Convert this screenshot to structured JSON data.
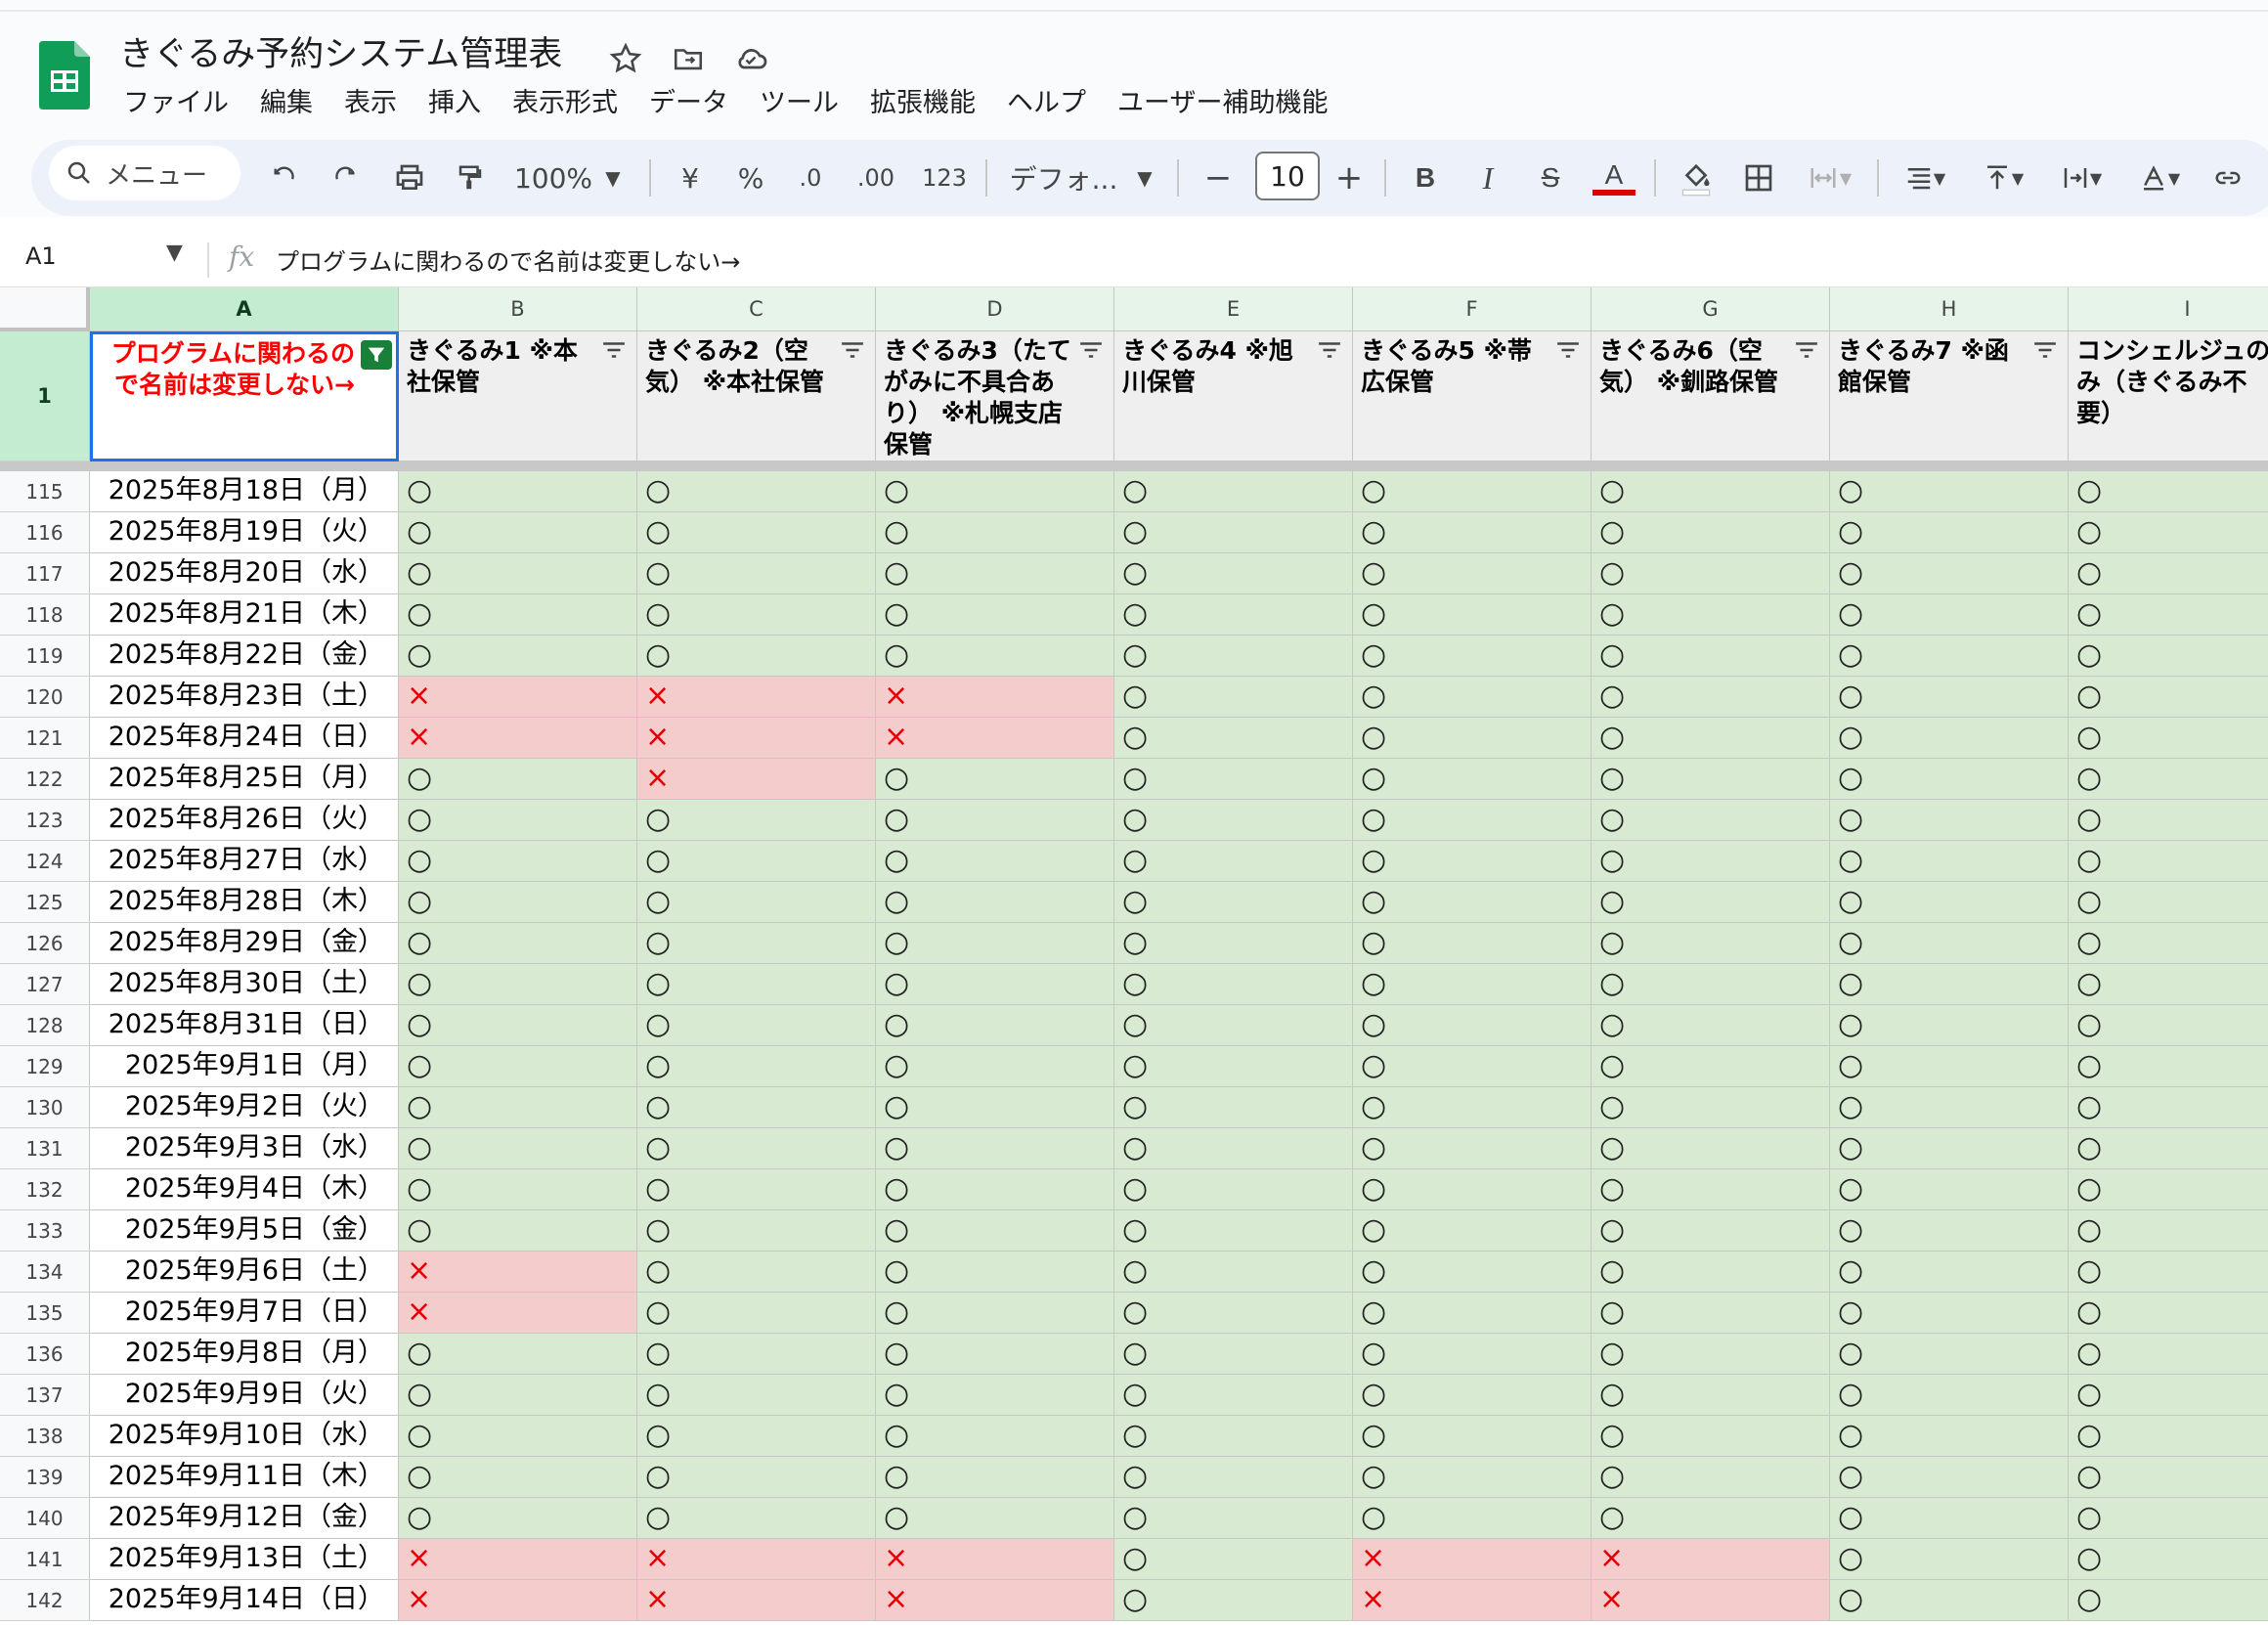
{
  "app": {
    "doc_title": "きぐるみ予約システム管理表",
    "menu": [
      "ファイル",
      "編集",
      "表示",
      "挿入",
      "表示形式",
      "データ",
      "ツール",
      "拡張機能",
      "ヘルプ",
      "ユーザー補助機能"
    ],
    "icons": [
      "star-icon",
      "move-folder-icon",
      "cloud-status-icon"
    ]
  },
  "toolbar": {
    "search_label": "メニュー",
    "zoom": "100%",
    "currency": "¥",
    "percent": "%",
    "decrease_decimal": ".0",
    "increase_decimal": ".00",
    "number_format": "123",
    "font": "デフォ...",
    "font_size": "10",
    "minus": "−",
    "plus": "+",
    "bold": "B",
    "italic": "I",
    "strike": "S",
    "text_color": "A"
  },
  "formula_bar": {
    "cell_ref": "A1",
    "fx": "fx",
    "content": "プログラムに関わるので名前は変更しない→"
  },
  "columns": [
    "A",
    "B",
    "C",
    "D",
    "E",
    "F",
    "G",
    "H",
    "I"
  ],
  "header_row_number": "1",
  "headers": [
    "プログラムに関わるので名前は変更しない→",
    "きぐるみ1 ※本社保管",
    "きぐるみ2（空気） ※本社保管",
    "きぐるみ3（たてがみに不具合あり） ※札幌支店保管",
    "きぐるみ4 ※旭川保管",
    "きぐるみ5 ※帯広保管",
    "きぐるみ6（空気） ※釧路保管",
    "きぐるみ7 ※函館保管",
    "コンシェルジュのみ（きぐるみ不要）"
  ],
  "rows": [
    {
      "num": "115",
      "date": "2025年8月18日（月）",
      "marks": [
        "○",
        "○",
        "○",
        "○",
        "○",
        "○",
        "○",
        "○"
      ]
    },
    {
      "num": "116",
      "date": "2025年8月19日（火）",
      "marks": [
        "○",
        "○",
        "○",
        "○",
        "○",
        "○",
        "○",
        "○"
      ]
    },
    {
      "num": "117",
      "date": "2025年8月20日（水）",
      "marks": [
        "○",
        "○",
        "○",
        "○",
        "○",
        "○",
        "○",
        "○"
      ]
    },
    {
      "num": "118",
      "date": "2025年8月21日（木）",
      "marks": [
        "○",
        "○",
        "○",
        "○",
        "○",
        "○",
        "○",
        "○"
      ]
    },
    {
      "num": "119",
      "date": "2025年8月22日（金）",
      "marks": [
        "○",
        "○",
        "○",
        "○",
        "○",
        "○",
        "○",
        "○"
      ]
    },
    {
      "num": "120",
      "date": "2025年8月23日（土）",
      "marks": [
        "×",
        "×",
        "×",
        "○",
        "○",
        "○",
        "○",
        "○"
      ]
    },
    {
      "num": "121",
      "date": "2025年8月24日（日）",
      "marks": [
        "×",
        "×",
        "×",
        "○",
        "○",
        "○",
        "○",
        "○"
      ]
    },
    {
      "num": "122",
      "date": "2025年8月25日（月）",
      "marks": [
        "○",
        "×",
        "○",
        "○",
        "○",
        "○",
        "○",
        "○"
      ]
    },
    {
      "num": "123",
      "date": "2025年8月26日（火）",
      "marks": [
        "○",
        "○",
        "○",
        "○",
        "○",
        "○",
        "○",
        "○"
      ]
    },
    {
      "num": "124",
      "date": "2025年8月27日（水）",
      "marks": [
        "○",
        "○",
        "○",
        "○",
        "○",
        "○",
        "○",
        "○"
      ]
    },
    {
      "num": "125",
      "date": "2025年8月28日（木）",
      "marks": [
        "○",
        "○",
        "○",
        "○",
        "○",
        "○",
        "○",
        "○"
      ]
    },
    {
      "num": "126",
      "date": "2025年8月29日（金）",
      "marks": [
        "○",
        "○",
        "○",
        "○",
        "○",
        "○",
        "○",
        "○"
      ]
    },
    {
      "num": "127",
      "date": "2025年8月30日（土）",
      "marks": [
        "○",
        "○",
        "○",
        "○",
        "○",
        "○",
        "○",
        "○"
      ]
    },
    {
      "num": "128",
      "date": "2025年8月31日（日）",
      "marks": [
        "○",
        "○",
        "○",
        "○",
        "○",
        "○",
        "○",
        "○"
      ]
    },
    {
      "num": "129",
      "date": "2025年9月1日（月）",
      "marks": [
        "○",
        "○",
        "○",
        "○",
        "○",
        "○",
        "○",
        "○"
      ]
    },
    {
      "num": "130",
      "date": "2025年9月2日（火）",
      "marks": [
        "○",
        "○",
        "○",
        "○",
        "○",
        "○",
        "○",
        "○"
      ]
    },
    {
      "num": "131",
      "date": "2025年9月3日（水）",
      "marks": [
        "○",
        "○",
        "○",
        "○",
        "○",
        "○",
        "○",
        "○"
      ]
    },
    {
      "num": "132",
      "date": "2025年9月4日（木）",
      "marks": [
        "○",
        "○",
        "○",
        "○",
        "○",
        "○",
        "○",
        "○"
      ]
    },
    {
      "num": "133",
      "date": "2025年9月5日（金）",
      "marks": [
        "○",
        "○",
        "○",
        "○",
        "○",
        "○",
        "○",
        "○"
      ]
    },
    {
      "num": "134",
      "date": "2025年9月6日（土）",
      "marks": [
        "×",
        "○",
        "○",
        "○",
        "○",
        "○",
        "○",
        "○"
      ]
    },
    {
      "num": "135",
      "date": "2025年9月7日（日）",
      "marks": [
        "×",
        "○",
        "○",
        "○",
        "○",
        "○",
        "○",
        "○"
      ]
    },
    {
      "num": "136",
      "date": "2025年9月8日（月）",
      "marks": [
        "○",
        "○",
        "○",
        "○",
        "○",
        "○",
        "○",
        "○"
      ]
    },
    {
      "num": "137",
      "date": "2025年9月9日（火）",
      "marks": [
        "○",
        "○",
        "○",
        "○",
        "○",
        "○",
        "○",
        "○"
      ]
    },
    {
      "num": "138",
      "date": "2025年9月10日（水）",
      "marks": [
        "○",
        "○",
        "○",
        "○",
        "○",
        "○",
        "○",
        "○"
      ]
    },
    {
      "num": "139",
      "date": "2025年9月11日（木）",
      "marks": [
        "○",
        "○",
        "○",
        "○",
        "○",
        "○",
        "○",
        "○"
      ]
    },
    {
      "num": "140",
      "date": "2025年9月12日（金）",
      "marks": [
        "○",
        "○",
        "○",
        "○",
        "○",
        "○",
        "○",
        "○"
      ]
    },
    {
      "num": "141",
      "date": "2025年9月13日（土）",
      "marks": [
        "×",
        "×",
        "×",
        "○",
        "×",
        "×",
        "○",
        "○"
      ]
    },
    {
      "num": "142",
      "date": "2025年9月14日（日）",
      "marks": [
        "×",
        "×",
        "×",
        "○",
        "×",
        "×",
        "○",
        "○"
      ]
    }
  ],
  "colors": {
    "available_bg": "#d9ead3",
    "unavailable_bg": "#f4cccc",
    "unavailable_mark": "#e00000",
    "warning_text": "#ff0000",
    "selection": "#1a73e8",
    "sheets_green": "#188038"
  }
}
